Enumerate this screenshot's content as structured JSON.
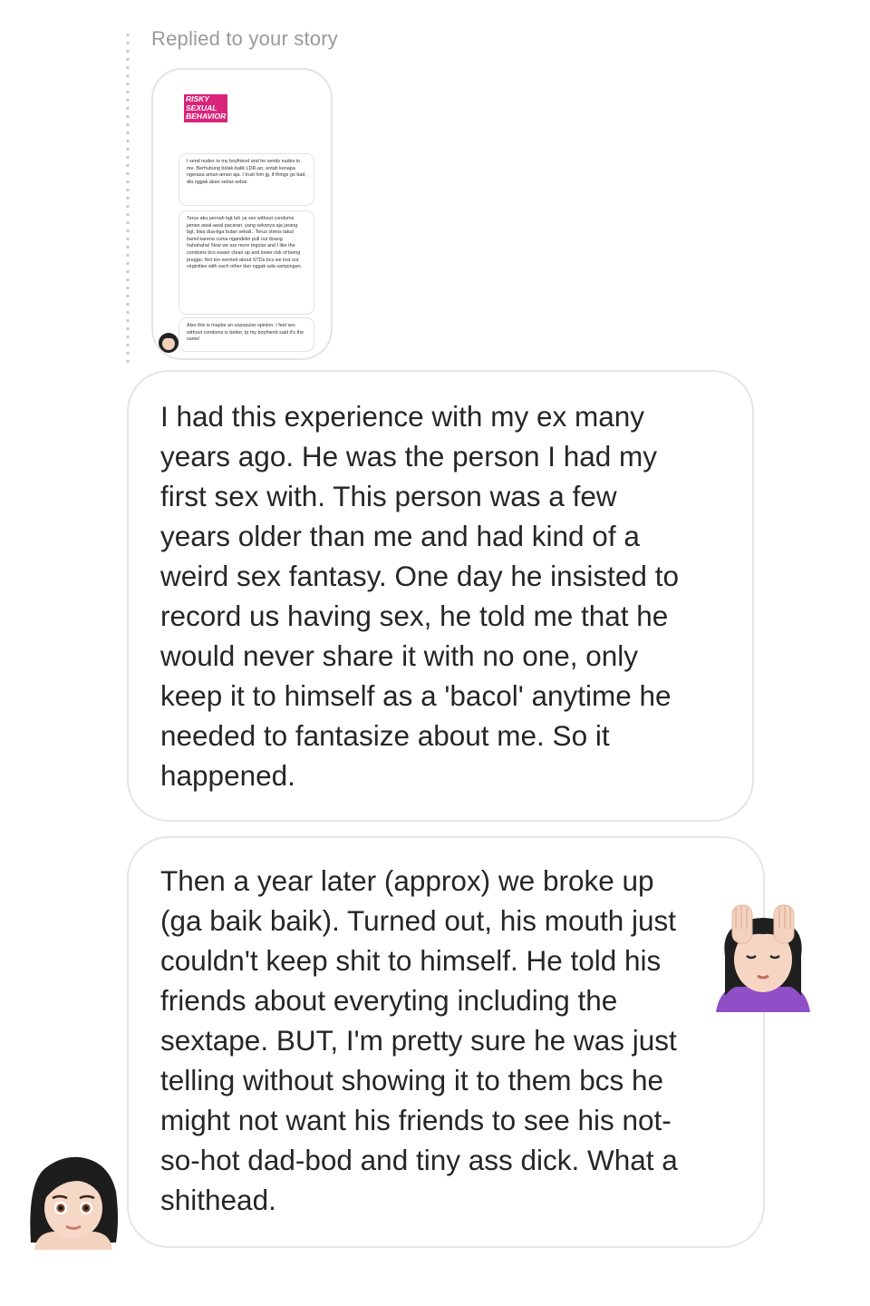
{
  "reply": {
    "label": "Replied to your story"
  },
  "story": {
    "header_text": "... ... ...",
    "tag_lines": [
      "RISKY",
      "SEXUAL",
      "BEHAVIOR"
    ],
    "bubbles": [
      "I send nudes to my boyfriend and he sends nudes to me. Berhubung bolak-balik LDR-an, entah kenapa ngerasa aman-aman aja. I trust him jg, if things go bad, dia nggak akan sebar-sebar.",
      "Terus aku pernah bgt lah ya sex without condoms jaman awal-awal pacaran, yang seksnya aja jarang bgt, bisa dua-tiga bulan sekali.. Terus stress takut hamil karena cuma ngandelin pull out doang hahahaha! Now we are more regular and I like the condoms bcs easier clean up and lower risk of being preggo. Not too worried about STDs bcs we lost our virginities with each other dan nggak ada sampingan.",
      "Also this is maybe an unpopular opinion. I feel sex without condoms is better, tp my boyfriend said it's the same!"
    ]
  },
  "messages": [
    {
      "text": "I had this experience with my ex many\nyears ago. He was the person I had my\nfirst sex with. This person was a few\nyears older than me and had kind of a\nweird sex fantasy. One day he insisted to\nrecord us having sex, he told me that he\nwould never share it with no one, only\nkeep it to himself as a 'bacol' anytime he\nneeded to fantasize about me. So it\nhappened."
    },
    {
      "text": "Then a year later (approx) we broke up\n(ga baik baik). Turned out, his mouth just\ncouldn't keep shit to himself. He told his\nfriends about everyting including the\nsextape. BUT, I'm pretty sure he was just\ntelling without showing it to them bcs he\nmight not want his friends to see his not-\nso-hot dad-bod and tiny ass dick. What a\nshithead."
    }
  ],
  "icons": {
    "reaction": "woman-getting-massage-emoji",
    "avatar": "woman-emoji-avatar"
  },
  "colors": {
    "tag_pink": "#d9247a",
    "bubble_border": "#e5e5e5",
    "label_gray": "#9a9a9a"
  }
}
